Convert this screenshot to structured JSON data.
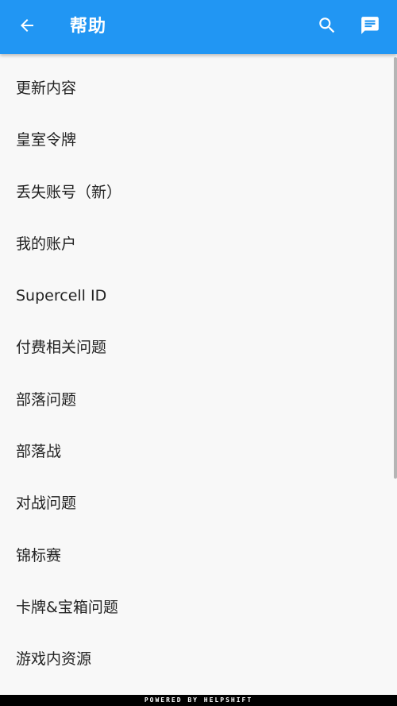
{
  "toolbar": {
    "title": "帮助",
    "back_icon": "arrow-left-icon",
    "search_icon": "search-icon",
    "chat_icon": "chat-message-icon",
    "background_color": "#2196f3"
  },
  "list": {
    "items": [
      {
        "label": "更新内容"
      },
      {
        "label": "皇室令牌"
      },
      {
        "label": "丢失账号（新）"
      },
      {
        "label": "我的账户"
      },
      {
        "label": "Supercell ID"
      },
      {
        "label": "付费相关问题"
      },
      {
        "label": "部落问题"
      },
      {
        "label": "部落战"
      },
      {
        "label": "对战问题"
      },
      {
        "label": "锦标赛"
      },
      {
        "label": "卡牌&宝箱问题"
      },
      {
        "label": "游戏内资源"
      }
    ]
  },
  "footer": {
    "text": "POWERED BY HELPSHIFT"
  }
}
